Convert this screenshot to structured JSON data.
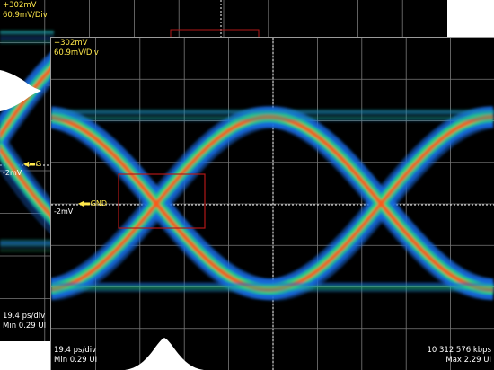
{
  "back": {
    "voltage_top": "+302mV",
    "volts_per_div": "60.9mV/Div",
    "ground_label": "G",
    "offset_label": "-2mV",
    "time_per_div": "19.4 ps/div",
    "min_ui": "Min 0.29 UI"
  },
  "front": {
    "voltage_top": "+302mV",
    "volts_per_div": "60.9mV/Div",
    "ground_label": "GND",
    "offset_label": "-2mV",
    "time_per_div": "19.4 ps/div",
    "min_ui": "Min 0.29 UI",
    "bitrate": "10 312 576 kbps",
    "max_ui": "Max 2.29 UI"
  },
  "colors": {
    "background": "#000000",
    "grid": "#7a7a7a",
    "center_line": "#ffffff",
    "annotation": "#ffe84a",
    "mask_box": "#b01818",
    "heat_low": "#1a6ae0",
    "heat_mid": "#24d37a",
    "heat_high": "#ff5a1a"
  }
}
